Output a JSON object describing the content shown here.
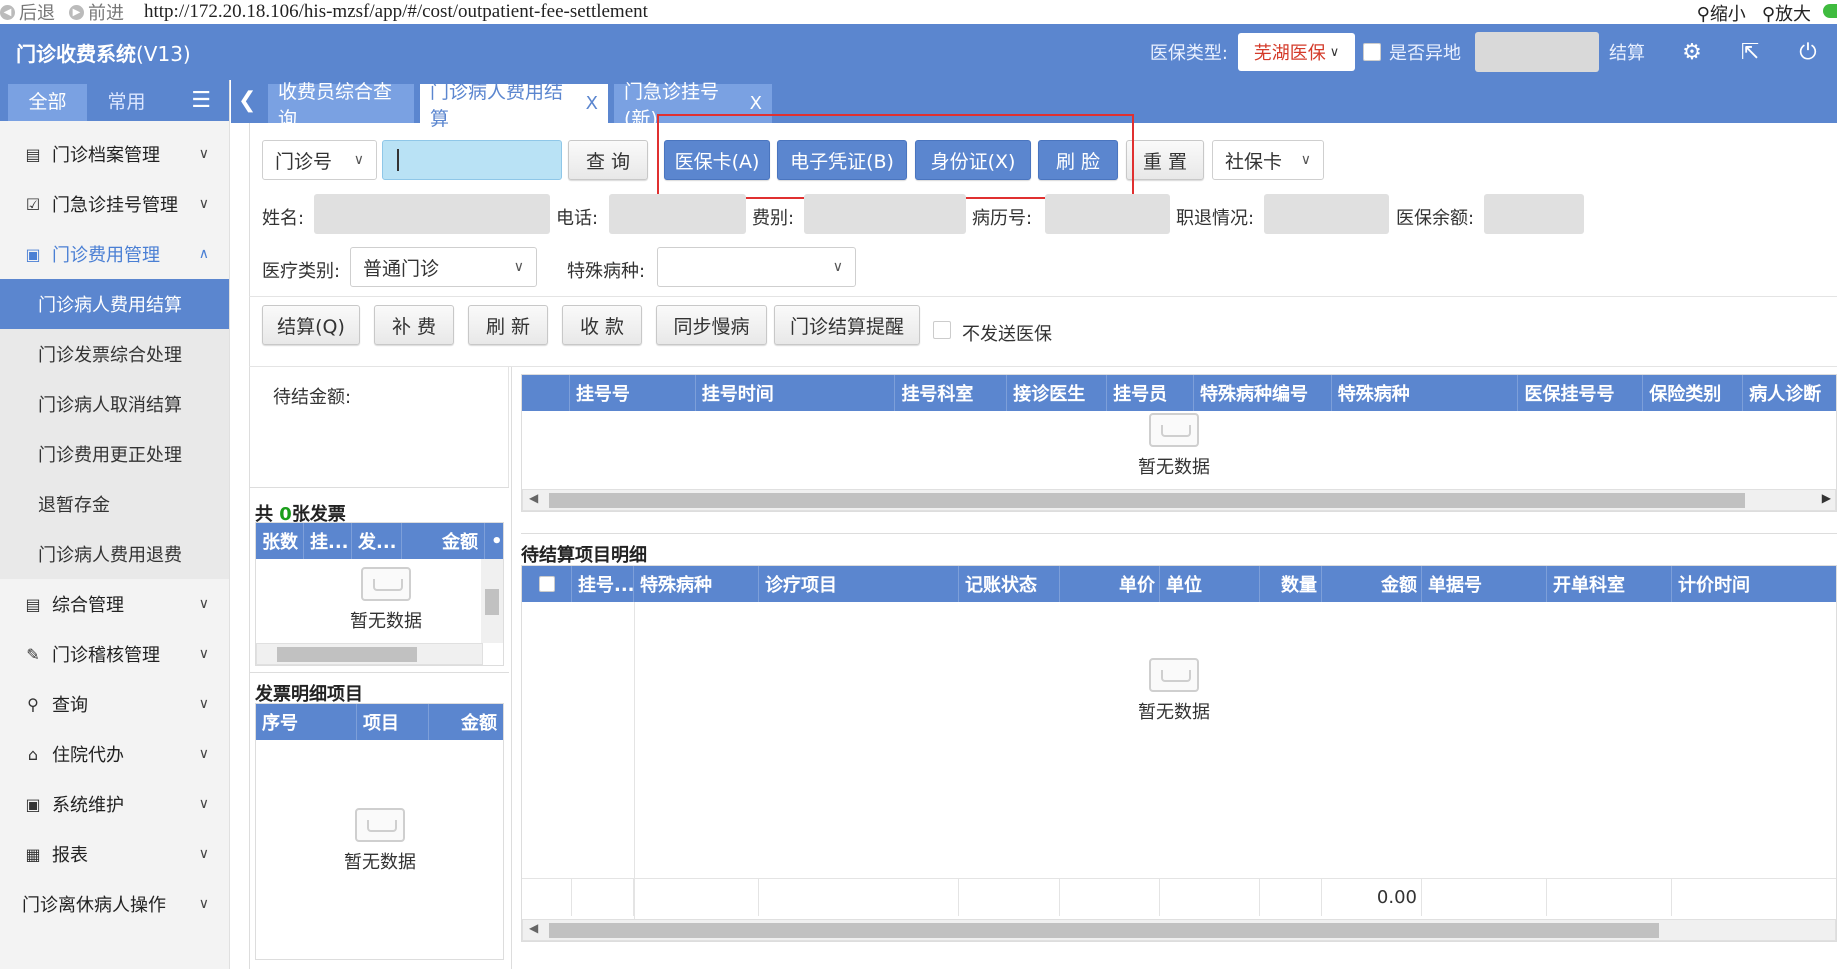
{
  "browser": {
    "back": "后退",
    "forward": "前进",
    "url": "http://172.20.18.106/his-mzsf/app/#/cost/outpatient-fee-settlement",
    "zoom_out": "缩小",
    "zoom_in": "放大"
  },
  "header": {
    "title": "门诊收费系统",
    "version": "(V13)",
    "insurance_type_label": "医保类型:",
    "insurance_type_value": "芜湖医保",
    "remote_label": "是否异地",
    "settle_label": "结算"
  },
  "sidebar": {
    "tabs": [
      "全部",
      "常用"
    ],
    "groups": [
      {
        "label": "门诊档案管理",
        "icon": "document-icon"
      },
      {
        "label": "门急诊挂号管理",
        "icon": "clipboard-icon"
      },
      {
        "label": "门诊费用管理",
        "icon": "fee-icon"
      }
    ],
    "sub_items": [
      "门诊病人费用结算",
      "门诊发票综合处理",
      "门诊病人取消结算",
      "门诊费用更正处理",
      "退暂存金",
      "门诊病人费用退费"
    ],
    "groups_after": [
      {
        "label": "综合管理",
        "icon": "report-icon"
      },
      {
        "label": "门诊稽核管理",
        "icon": "audit-icon"
      },
      {
        "label": "查询",
        "icon": "search-icon"
      },
      {
        "label": "住院代办",
        "icon": "hospital-icon"
      },
      {
        "label": "系统维护",
        "icon": "monitor-icon"
      },
      {
        "label": "报表",
        "icon": "chart-icon"
      },
      {
        "label": "门诊离休病人操作",
        "icon": "none"
      }
    ]
  },
  "tabs": [
    {
      "label": "收费员综合查询"
    },
    {
      "label": "门诊病人费用结算",
      "close": "X"
    },
    {
      "label": "门急诊挂号(新)",
      "close": "X"
    }
  ],
  "search": {
    "id_type": "门诊号",
    "query_btn": "查 询",
    "med_card_btn": "医保卡(A)",
    "e_cert_btn": "电子凭证(B)",
    "id_card_btn": "身份证(X)",
    "face_btn": "刷 脸",
    "reset_btn": "重 置",
    "social_card": "社保卡"
  },
  "patient": {
    "name_label": "姓名:",
    "phone_label": "电话:",
    "fee_type_label": "费别:",
    "record_label": "病历号:",
    "job_label": "职退情况:",
    "balance_label": "医保余额:",
    "med_category_label": "医疗类别:",
    "med_category_value": "普通门诊",
    "special_disease_label": "特殊病种:"
  },
  "actions": {
    "settle": "结算(Q)",
    "supplement": "补 费",
    "refresh": "刷 新",
    "collect": "收 款",
    "sync": "同步慢病",
    "reminder": "门诊结算提醒",
    "no_send": "不发送医保"
  },
  "left_panel": {
    "pending_label": "待结金额:",
    "invoice_prefix": "共",
    "invoice_count": "0",
    "invoice_suffix": "张发票",
    "invoice_cols": [
      "张数",
      "挂...",
      "发...",
      "金额",
      "•"
    ],
    "empty": "暂无数据",
    "detail_title": "发票明细项目",
    "detail_cols": [
      "序号",
      "项目",
      "金额"
    ]
  },
  "reg_grid": {
    "cols": [
      "挂号号",
      "挂号时间",
      "挂号科室",
      "接诊医生",
      "挂号员",
      "特殊病种编号",
      "特殊病种",
      "医保挂号号",
      "保险类别",
      "病人诊断"
    ],
    "empty": "暂无数据"
  },
  "pending_grid": {
    "title": "待结算项目明细",
    "cols": [
      "挂号...",
      "特殊病种",
      "诊疗项目",
      "记账状态",
      "单价",
      "单位",
      "数量",
      "金额",
      "单据号",
      "开单科室",
      "计价时间"
    ],
    "empty": "暂无数据",
    "total": "0.00"
  },
  "colors": {
    "primary": "#5b86cf",
    "tab": "#7aa1e2",
    "highlight": "#e03030"
  }
}
